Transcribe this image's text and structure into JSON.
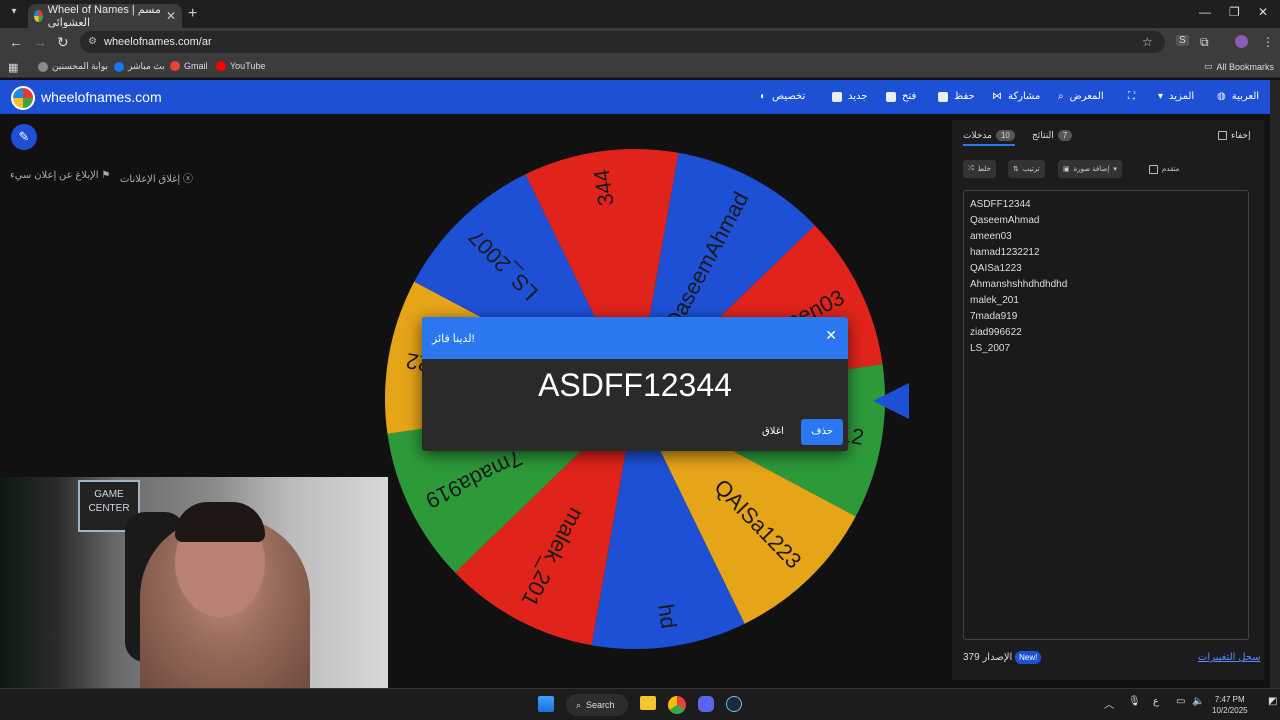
{
  "browser": {
    "tab_title": "Wheel of Names | مسم العشوائي",
    "url": "wheelofnames.com/ar",
    "bookmarks": [
      "بوابة المحسنين",
      "بث مباشر",
      "Gmail",
      "YouTube"
    ],
    "all_bookmarks": "All Bookmarks"
  },
  "app": {
    "brand": "wheelofnames.com",
    "menu": [
      "العربية",
      "المزيد",
      "المعرض",
      "مشاركة",
      "حفظ",
      "فتح",
      "جديد",
      "تخصيص"
    ],
    "report_ad": "الإبلاغ عن إعلان سيء",
    "close_ads": "إغلاق الإعلانات"
  },
  "sidebar": {
    "entries_tab_label": "مدخلات",
    "entries_count": "10",
    "results_tab_label": "النتائج",
    "results_count": "7",
    "hide_label": "إخفاء",
    "shuffle_label": "خلط",
    "sort_label": "ترتيب",
    "add_image_label": "إضافة صورة",
    "advanced_label": "متقدم",
    "entries": [
      "ASDFF12344",
      "QaseemAhmad",
      "ameen03",
      "hamad1232212",
      "QAISa1223",
      "Ahmanshshhdhdhdhd",
      "malek_201",
      "7mada919",
      "ziad996622",
      "LS_2007"
    ],
    "version_label": "الإصدار",
    "version": "379",
    "new_badge": "New!",
    "changelog": "سجل التغييرات"
  },
  "wheel": {
    "colors": [
      "#1e50d6",
      "#e0241b",
      "#2d9a3a",
      "#e6a419"
    ],
    "labels": [
      "QaseemAhmad",
      "ameen03",
      "hamad1232212",
      "QAISa1223",
      "hd",
      "malek_201",
      "7mada919",
      "ziad996622",
      "LS_2007",
      "344"
    ]
  },
  "dialog": {
    "title": "لدينا فائز!",
    "winner": "ASDFF12344",
    "remove_label": "حذف",
    "close_label": "اغلاق"
  },
  "webcam": {
    "sign": "GAME CENTER"
  },
  "taskbar": {
    "search_label": "Search",
    "lang": "ع",
    "time": "7:47 PM",
    "date": "10/2/2025"
  }
}
